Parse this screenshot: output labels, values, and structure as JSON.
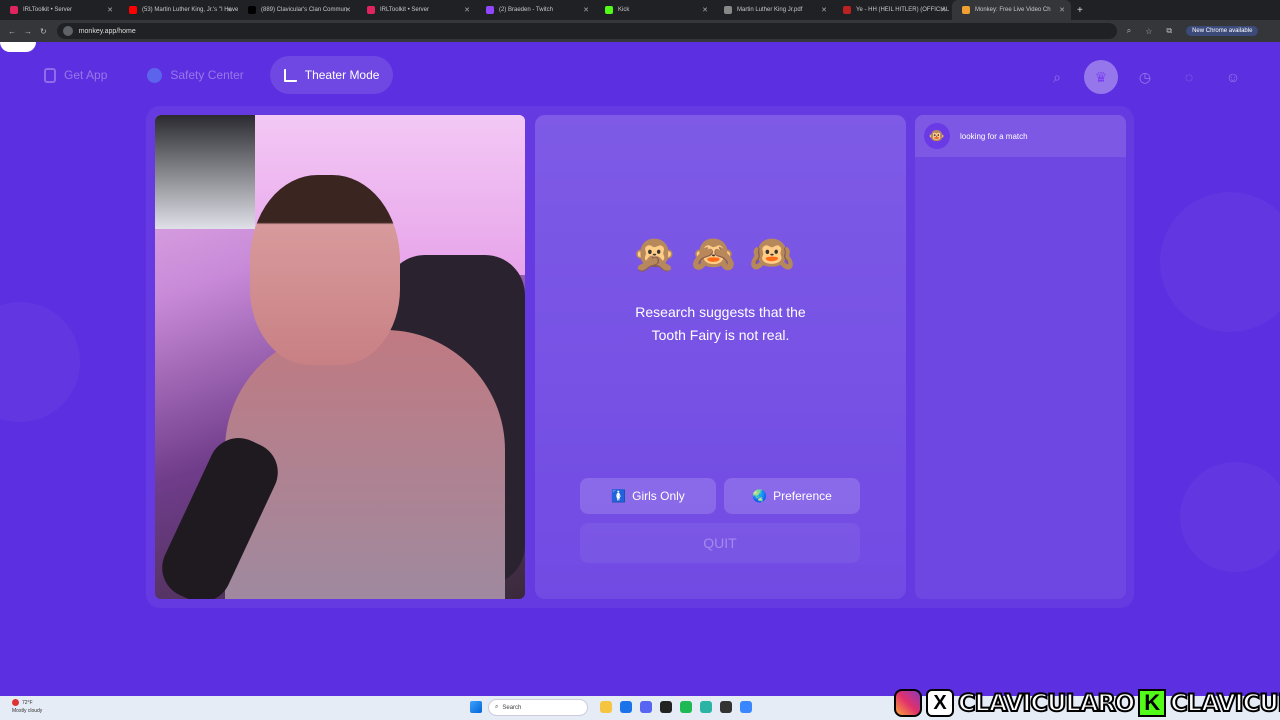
{
  "browser": {
    "tabs": [
      {
        "title": "IRLToolkit • Server",
        "color": "#e0245e",
        "active": false
      },
      {
        "title": "(53) Martin Luther King, Jr.'s \"I Have",
        "color": "#ff0000",
        "active": false
      },
      {
        "title": "(889) Clavicular's Clan Commun",
        "color": "#000000",
        "active": false
      },
      {
        "title": "IRLToolkit • Server",
        "color": "#e0245e",
        "active": false
      },
      {
        "title": "(2) Braeden - Twitch",
        "color": "#9146ff",
        "active": false
      },
      {
        "title": "Kick",
        "color": "#53fc18",
        "active": false
      },
      {
        "title": "Martin Luther King Jr.pdf",
        "color": "#888888",
        "active": false
      },
      {
        "title": "Ye - HH (HEIL HITLER) (OFFICIAL",
        "color": "#b22",
        "active": false
      },
      {
        "title": "Monkey: Free Live Video Ch",
        "color": "#f0a030",
        "active": true
      }
    ],
    "url": "monkey.app/home",
    "new_chrome_label": "New Chrome available"
  },
  "topnav": {
    "get_app": "Get App",
    "safety_center": "Safety Center",
    "theater_mode": "Theater Mode"
  },
  "main": {
    "monkeys": "🙊🙈🙉",
    "fact_line1": "Research suggests that the",
    "fact_line2": "Tooth Fairy is not real.",
    "girls_only_icon": "🚺",
    "girls_only": "Girls Only",
    "preference_icon": "🌏",
    "preference": "Preference",
    "quit": "QUIT"
  },
  "chat": {
    "avatar": "🐵",
    "status": "looking for a match"
  },
  "taskbar": {
    "temperature": "72°F",
    "weather": "Mostly cloudy",
    "search_placeholder": "Search"
  },
  "overlay": {
    "handle1": "CLAVICULARO",
    "handle2": "CLAVICULAR",
    "kick_letter": "K",
    "x_letter": "X"
  },
  "colors": {
    "page_bg": "#5c2fe0",
    "accent": "#7a3ff0"
  }
}
